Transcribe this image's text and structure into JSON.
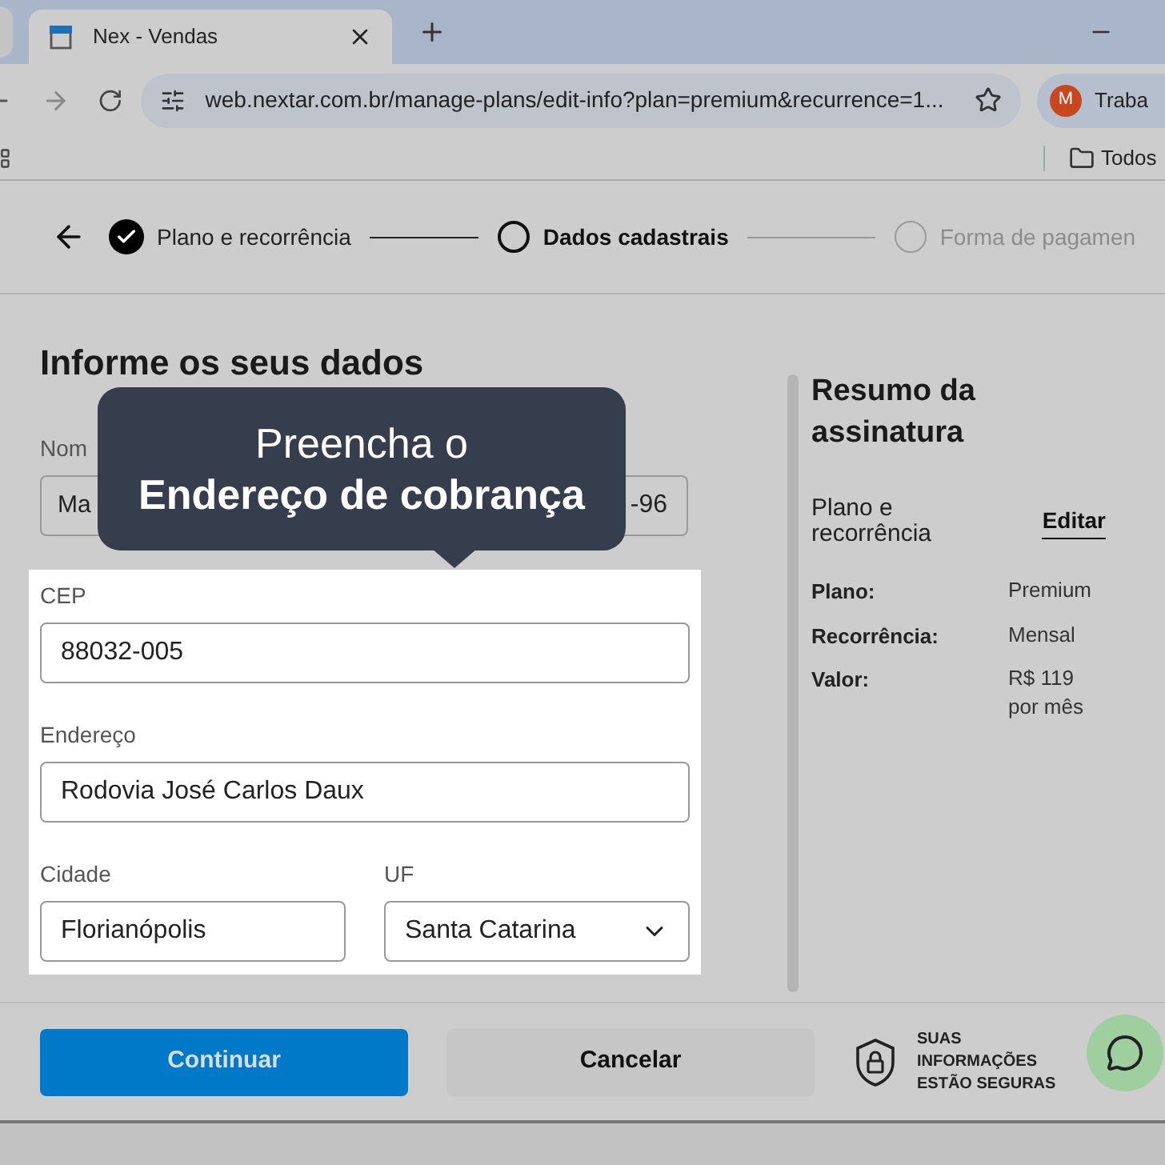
{
  "browser": {
    "tabs": [
      {
        "title": "Nex - Vendas",
        "selected": true
      }
    ],
    "url": "web.nextar.com.br/manage-plans/edit-info?plan=premium&recurrence=1...",
    "profile": {
      "initial": "M",
      "label": "Traba"
    },
    "bookmarks": [
      {
        "label": "Todos"
      }
    ]
  },
  "stepper": {
    "steps": [
      {
        "label": "Plano e recorrência",
        "kind": "done"
      },
      {
        "label": "Dados cadastrais",
        "kind": "current"
      },
      {
        "label": "Forma de pagamen",
        "kind": "pending"
      }
    ]
  },
  "form": {
    "heading": "Informe os seus dados",
    "name_label": "Nom",
    "name_value": "Ma",
    "phone_value": "-96",
    "address_fields": [
      {
        "label": "CEP",
        "value": "88032-005"
      },
      {
        "label": "Endereço",
        "value": "Rodovia José Carlos Daux"
      }
    ],
    "city": {
      "label": "Cidade",
      "value": "Florianópolis"
    },
    "state": {
      "label": "UF",
      "value": "Santa Catarina"
    }
  },
  "tooltip": {
    "text": "Preencha o\n**Endereço de cobrança**"
  },
  "summary": {
    "title": "Resumo da assinatura",
    "section": "Plano e recorrência",
    "edit_link": "Editar",
    "rows": [
      {
        "label": "Plano:",
        "value": "Premium"
      },
      {
        "label": "Recorrência:",
        "value": "Mensal"
      },
      {
        "label": "Valor:",
        "value": "R$ 119 por mês"
      }
    ]
  },
  "footer": {
    "continue": "Continuar",
    "cancel": "Cancelar",
    "security_note": "SUAS INFORMAÇÕES ESTÃO SEGURAS"
  }
}
